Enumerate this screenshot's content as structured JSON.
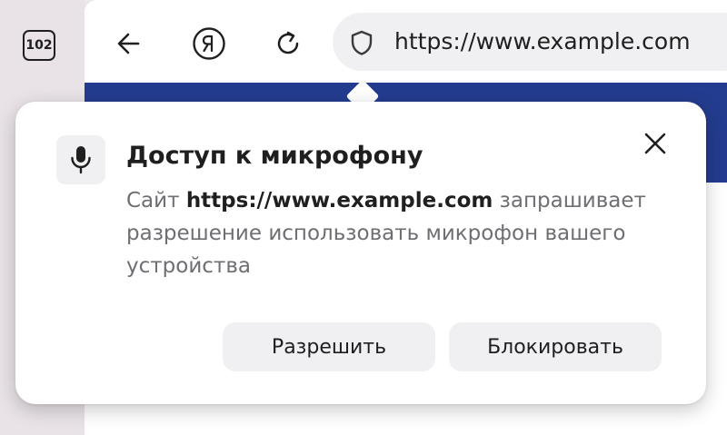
{
  "tabs": {
    "count": "102"
  },
  "toolbar": {
    "back_icon": "arrow-left-icon",
    "yandex_icon": "yandex-logo-icon",
    "reload_icon": "reload-icon",
    "url": "https://www.example.com",
    "secure_icon": "shield-icon"
  },
  "popup": {
    "icon": "microphone-icon",
    "title": "Доступ к микрофону",
    "message_prefix": "Сайт",
    "message_site": "https://www.example.com",
    "message_suffix": "запрашивает разрешение использовать микрофон вашего устройства",
    "allow_label": "Разрешить",
    "block_label": "Блокировать",
    "close_icon": "close-icon"
  },
  "colors": {
    "accent_band": "#243c8f",
    "button_bg": "#f0eff2",
    "text_primary": "#1f1f1f",
    "text_secondary": "#6e6e73"
  }
}
